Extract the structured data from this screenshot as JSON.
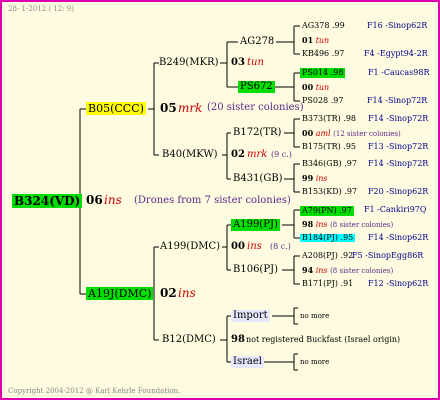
{
  "header": {
    "date": "28-  1-2012 ( 12:  9)"
  },
  "footer": {
    "copyright": "Copyright 2004-2012 @ Karl Kehrle Foundation."
  },
  "root": {
    "id": "B324(VD)",
    "year": "06",
    "sign": "ins",
    "note": "(Drones from 7 sister colonies)"
  },
  "father_side": {
    "id": "B05(CCC)",
    "year": "05",
    "sign": "mrk",
    "note": "(20 sister colonies)",
    "ff": {
      "id": "B249(MKR)",
      "year": "03",
      "sign": "tun",
      "fff": {
        "id": "AG278"
      },
      "ffm": {
        "id": "PS672"
      },
      "ends": [
        {
          "id": "AG378",
          "num": ".99",
          "loc": "F16 -Sinop62R"
        },
        {
          "id": "01",
          "sign": "tun",
          "loc": ""
        },
        {
          "id": "KB496",
          "num": ".97",
          "loc": "F4 -Egypt94-2R"
        },
        {
          "id": "PS014",
          "num": ".98",
          "loc": "F1 -Caucas98R"
        },
        {
          "id": "00",
          "sign": "tun",
          "loc": ""
        },
        {
          "id": "PS028",
          "num": ".97",
          "loc": "F14 -Sinop72R"
        }
      ]
    },
    "fm": {
      "id": "B40(MKW)",
      "year": "02",
      "sign": "mrk",
      "note": "(9 c.)",
      "fmf": {
        "id": "B172(TR)",
        "year": "00",
        "sign": "aml",
        "note": "(12 sister colonies)"
      },
      "fmm": {
        "id": "B431(GB)",
        "year": "99",
        "sign": "ins"
      },
      "ends": [
        {
          "id": "B373(TR)",
          "num": ".98",
          "loc": "F14 -Sinop72R"
        },
        {
          "id": "B175(TR)",
          "num": ".95",
          "loc": "F13 -Sinop72R"
        },
        {
          "id": "B346(GB)",
          "num": ".97",
          "loc": "F14 -Sinop72R"
        },
        {
          "id": "B153(KD)",
          "num": ".97",
          "loc": "F20 -Sinop62R"
        }
      ]
    }
  },
  "mother_side": {
    "id": "A19J(DMC)",
    "year": "02",
    "sign": "ins",
    "mf": {
      "id": "A199(DMC)",
      "year": "00",
      "sign": "ins",
      "note": "(8 c.)",
      "mff": {
        "id": "A199(PJ)",
        "year": "98",
        "sign": "ins",
        "note": "(8 sister colonies)"
      },
      "mfm": {
        "id": "B106(PJ)",
        "year": "94",
        "sign": "ins",
        "note": "(8 sister colonies)"
      },
      "ends": [
        {
          "id": "A79(PN)",
          "num": ".97",
          "loc": "F1 -Cankiri97Q"
        },
        {
          "id": "B184(PJ)",
          "num": ".95",
          "loc": "F14 -Sinop62R"
        },
        {
          "id": "A208(PJ)",
          "num": ".92",
          "loc": "F5 -SinopEgg86R"
        },
        {
          "id": "B171(PJ)",
          "num": ".91",
          "loc": "F12 -Sinop62R"
        }
      ]
    },
    "mm": {
      "id": "B12(DMC)",
      "year": "98",
      "note": "not registered Buckfast (Israel origin)",
      "mmf": {
        "id": "Import",
        "more": "no more"
      },
      "mmm": {
        "id": "Israel",
        "more": "no more"
      }
    }
  }
}
